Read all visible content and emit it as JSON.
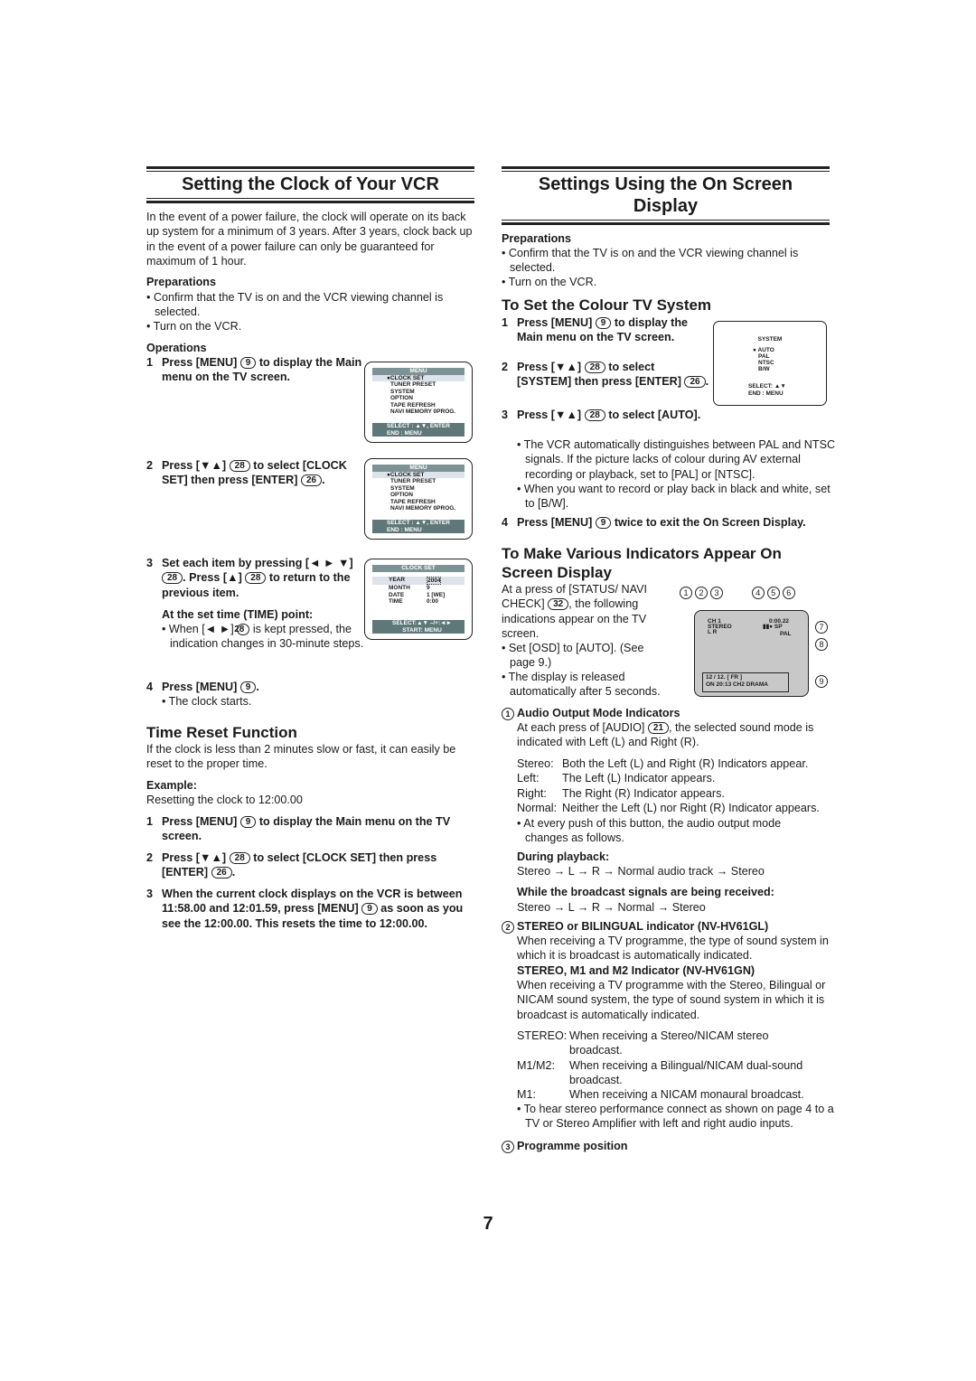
{
  "left": {
    "title": "Setting the Clock of Your VCR",
    "intro": "In the event of a power failure, the clock will operate on its back up system for a minimum of 3 years. After 3 years, clock back up in the event of a power failure can only be guaranteed for maximum of 1 hour.",
    "prep_heading": "Preparations",
    "prep": [
      "• Confirm that the TV is on and the VCR viewing channel is selected.",
      "• Turn on the VCR."
    ],
    "ops_heading": "Operations",
    "steps": [
      {
        "n": "1",
        "a": "Press [MENU]",
        "r": "9",
        "b": "to display the Main menu on the TV screen."
      },
      {
        "n": "2",
        "a": "Press [▼▲]",
        "r": "28",
        "b": "to select [CLOCK SET] then press [ENTER]",
        "r2": "26",
        "c": "."
      },
      {
        "n": "3",
        "a": "Set each item by pressing [◄ ► ▼]",
        "r": "28",
        "b": ". Press [▲]",
        "r2": "28",
        "c": "to return to the previous item."
      },
      {
        "n": "4",
        "a": "Press [MENU]",
        "r": "9",
        "b": "."
      }
    ],
    "time_point_heading": "At the set time (TIME) point:",
    "time_point": {
      "a": "• When [◄ ►]",
      "r": "28",
      "b": "is kept pressed, the indication changes in 30-minute steps."
    },
    "clock_starts": "• The clock starts.",
    "reset_title": "Time Reset Function",
    "reset_intro": "If the clock is less than 2 minutes slow or fast, it can easily be reset to the proper time.",
    "example_heading": "Example:",
    "example": "Resetting the clock to 12:00.00",
    "reset_steps": [
      {
        "n": "1",
        "a": "Press [MENU]",
        "r": "9",
        "b": "to display the Main menu on the TV screen."
      },
      {
        "n": "2",
        "a": "Press [▼▲]",
        "r": "28",
        "b": "to select [CLOCK SET] then press [ENTER]",
        "r2": "26",
        "c": "."
      },
      {
        "n": "3",
        "a": "When the current clock displays on the VCR is between 11:58.00 and 12:01.59, press [MENU]",
        "r": "9",
        "b": "as soon as you see the 12:00.00. This resets the time to 12:00.00."
      }
    ],
    "osd_menu": {
      "header": "MENU",
      "items": [
        "●CLOCK SET",
        "TUNER PRESET",
        "SYSTEM",
        "OPTION",
        "TAPE REFRESH",
        "NAVI MEMORY 0PROG."
      ],
      "footer1": "SELECT : ▲▼, ENTER",
      "footer2": "END      : MENU"
    },
    "osd_clock": {
      "header": "CLOCK SET",
      "rows": [
        [
          "YEAR",
          "2004"
        ],
        [
          "MONTH",
          "9"
        ],
        [
          "DATE",
          "1 [WE]"
        ],
        [
          "TIME",
          "0:00"
        ]
      ],
      "footer1": "SELECT:▲▼          –/+:◄►",
      "footer2": "START: MENU"
    }
  },
  "right": {
    "title": "Settings Using the On Screen Display",
    "prep_heading": "Preparations",
    "prep": [
      "• Confirm that the TV is on and the VCR viewing channel is selected.",
      "• Turn on the VCR."
    ],
    "colour_title": "To Set the Colour TV System",
    "colour_steps": [
      {
        "n": "1",
        "a": "Press [MENU]",
        "r": "9",
        "b": "to display the Main menu on the TV screen."
      },
      {
        "n": "2",
        "a": "Press [▼▲]",
        "r": "28",
        "b": "to select [SYSTEM] then press [ENTER]",
        "r2": "26",
        "c": "."
      },
      {
        "n": "3",
        "a": "Press [▼▲]",
        "r": "28",
        "b": "to select [AUTO]."
      },
      {
        "n": "4",
        "a": "Press [MENU]",
        "r": "9",
        "b": "twice to exit the On Screen Display."
      }
    ],
    "colour_notes": [
      "• The VCR automatically distinguishes between PAL and NTSC signals. If the picture lacks of colour during AV external recording or playback, set to [PAL] or [NTSC].",
      "• When you want to record or play back in black and white, set to [B/W]."
    ],
    "osd_system": {
      "header": "SYSTEM",
      "items": [
        "● AUTO",
        "PAL",
        "NTSC",
        "B/W"
      ],
      "footer1": "SELECT: ▲▼",
      "footer2": "END      : MENU"
    },
    "ind_title": "To Make Various Indicators Appear On Screen Display",
    "ind_intro_a": "At a press of [STATUS/ NAVI CHECK]",
    "ind_intro_r": "32",
    "ind_intro_b": ", the following indications appear on the TV screen.",
    "ind_notes": [
      "• Set [OSD] to [AUTO]. (See page 9.)",
      "• The display is released automatically after 5 seconds."
    ],
    "screen": {
      "callouts": [
        "1",
        "2",
        "3",
        "4",
        "5",
        "6",
        "7",
        "8",
        "9"
      ],
      "ch": "CH 1",
      "stereo": "STEREO",
      "lr": "L  R",
      "time": "0:00.22",
      "mode": "SP",
      "system": "PAL",
      "navi1": "12 / 12.    [ FR ]",
      "navi2": "ON  20:13  CH2     DRAMA"
    },
    "audio_heading": "Audio Output Mode Indicators",
    "audio_num": "1",
    "audio_intro_a": "At each press of [AUDIO]",
    "audio_intro_r": "21",
    "audio_intro_b": ", the selected sound mode is indicated with Left (L) and Right (R).",
    "audio_modes": [
      [
        "Stereo:",
        "Both the Left (L) and Right (R) Indicators appear."
      ],
      [
        "Left:",
        "The Left (L) Indicator appears."
      ],
      [
        "Right:",
        "The Right (R) Indicator appears."
      ],
      [
        "Normal:",
        "Neither the Left (L) nor Right (R) Indicator appears."
      ]
    ],
    "audio_note": "• At every push of this button, the audio output mode changes as follows.",
    "playback_heading": "During playback:",
    "playback": "Stereo → L → R → Normal audio track → Stereo",
    "broadcast_heading": "While the broadcast signals are being received:",
    "broadcast": "Stereo → L → R → Normal → Stereo",
    "stereo_num": "2",
    "stereo_heading": "STEREO or BILINGUAL indicator (NV-HV61GL)",
    "stereo_text": "When receiving a TV programme, the type of sound system in which it is broadcast is automatically indicated.",
    "m1_heading": "STEREO, M1 and M2 Indicator (NV-HV61GN)",
    "m1_text": "When receiving a TV programme with the Stereo, Bilingual or NICAM sound system, the type of sound system in which it is broadcast is automatically indicated.",
    "m1_modes": [
      [
        "STEREO:",
        "When receiving a Stereo/NICAM stereo broadcast."
      ],
      [
        "M1/M2:",
        "When receiving a Bilingual/NICAM dual-sound broadcast."
      ],
      [
        "M1:",
        "When receiving a NICAM monaural broadcast."
      ]
    ],
    "m1_note": "• To hear stereo performance connect as shown on page 4 to a TV or Stereo Amplifier with left and right audio inputs.",
    "prog_num": "3",
    "prog_heading": "Programme position"
  },
  "page_number": "7"
}
